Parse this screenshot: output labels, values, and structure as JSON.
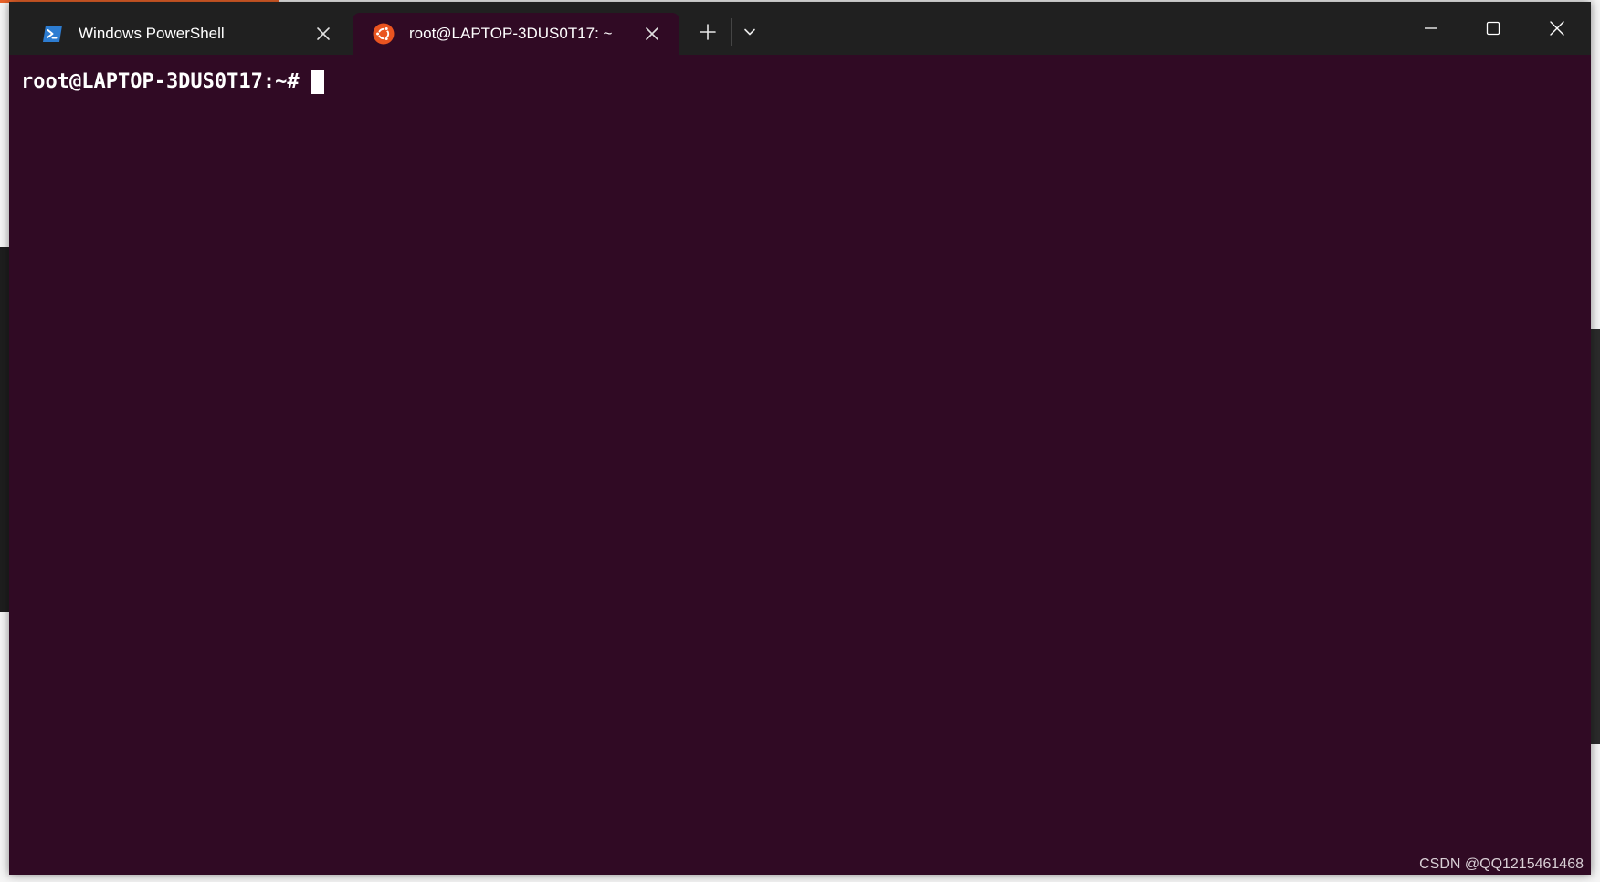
{
  "window": {
    "tabs": [
      {
        "label": "Windows PowerShell",
        "icon": "powershell-icon",
        "active": false
      },
      {
        "label": "root@LAPTOP-3DUS0T17: ~",
        "icon": "ubuntu-icon",
        "active": true
      }
    ],
    "buttons": {
      "new_tab": "plus-icon",
      "dropdown": "chevron-down-icon",
      "minimize": "minimize-icon",
      "maximize": "maximize-icon",
      "close": "close-icon"
    }
  },
  "terminal": {
    "prompt": "root@LAPTOP-3DUS0T17:~#",
    "background_color": "#300a24",
    "text_color": "#ffffff"
  },
  "watermark": "CSDN @QQ1215461468",
  "colors": {
    "titlebar": "#202020",
    "powershell_blue": "#2d7dd2",
    "ubuntu_orange": "#e95420"
  }
}
